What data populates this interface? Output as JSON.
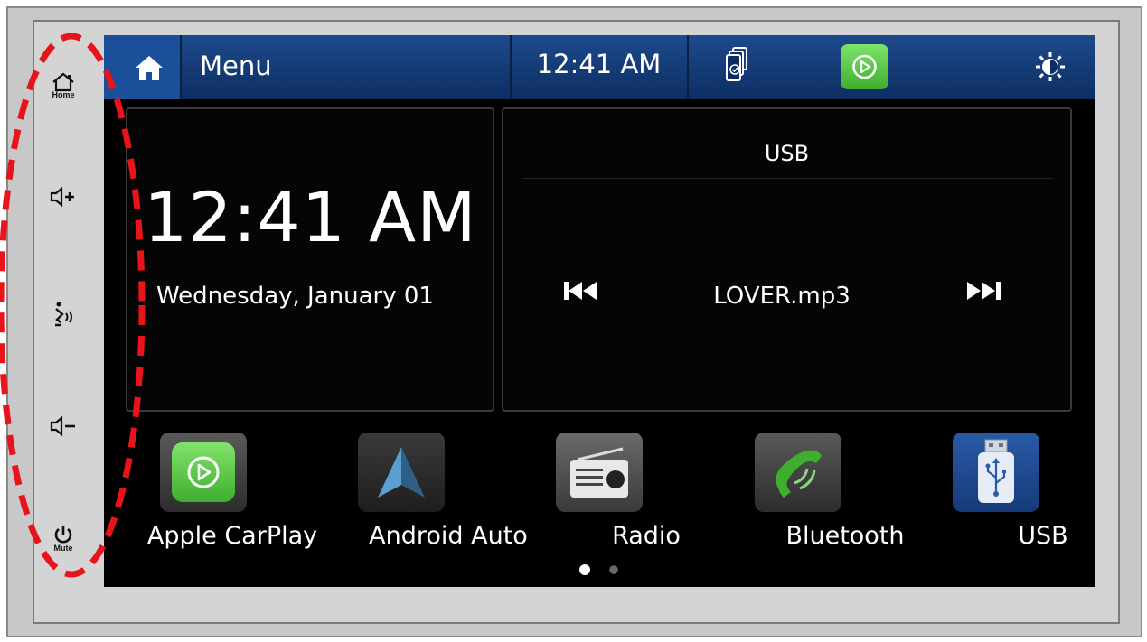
{
  "side_buttons": {
    "home_caption": "Home",
    "mute_caption": "Mute",
    "icons": [
      "home-icon",
      "volume-up-icon",
      "voice-icon",
      "volume-down-icon",
      "power-icon"
    ]
  },
  "topbar": {
    "menu_label": "Menu",
    "time": "12:41 AM",
    "icons": [
      "home-icon",
      "phone-link-icon",
      "carplay-icon",
      "brightness-icon"
    ]
  },
  "clock": {
    "time": "12:41 AM",
    "date": "Wednesday, January 01"
  },
  "media": {
    "source": "USB",
    "track": "LOVER.mp3"
  },
  "apps": [
    {
      "label": "Apple CarPlay"
    },
    {
      "label": "Android Auto"
    },
    {
      "label": "Radio"
    },
    {
      "label": "Bluetooth"
    },
    {
      "label": "USB"
    }
  ],
  "page_dots": {
    "count": 2,
    "active": 1
  },
  "colors": {
    "topbar": "#0d2e63",
    "carplay_green": "#4cc23a",
    "annotation_red": "#e8141c"
  }
}
